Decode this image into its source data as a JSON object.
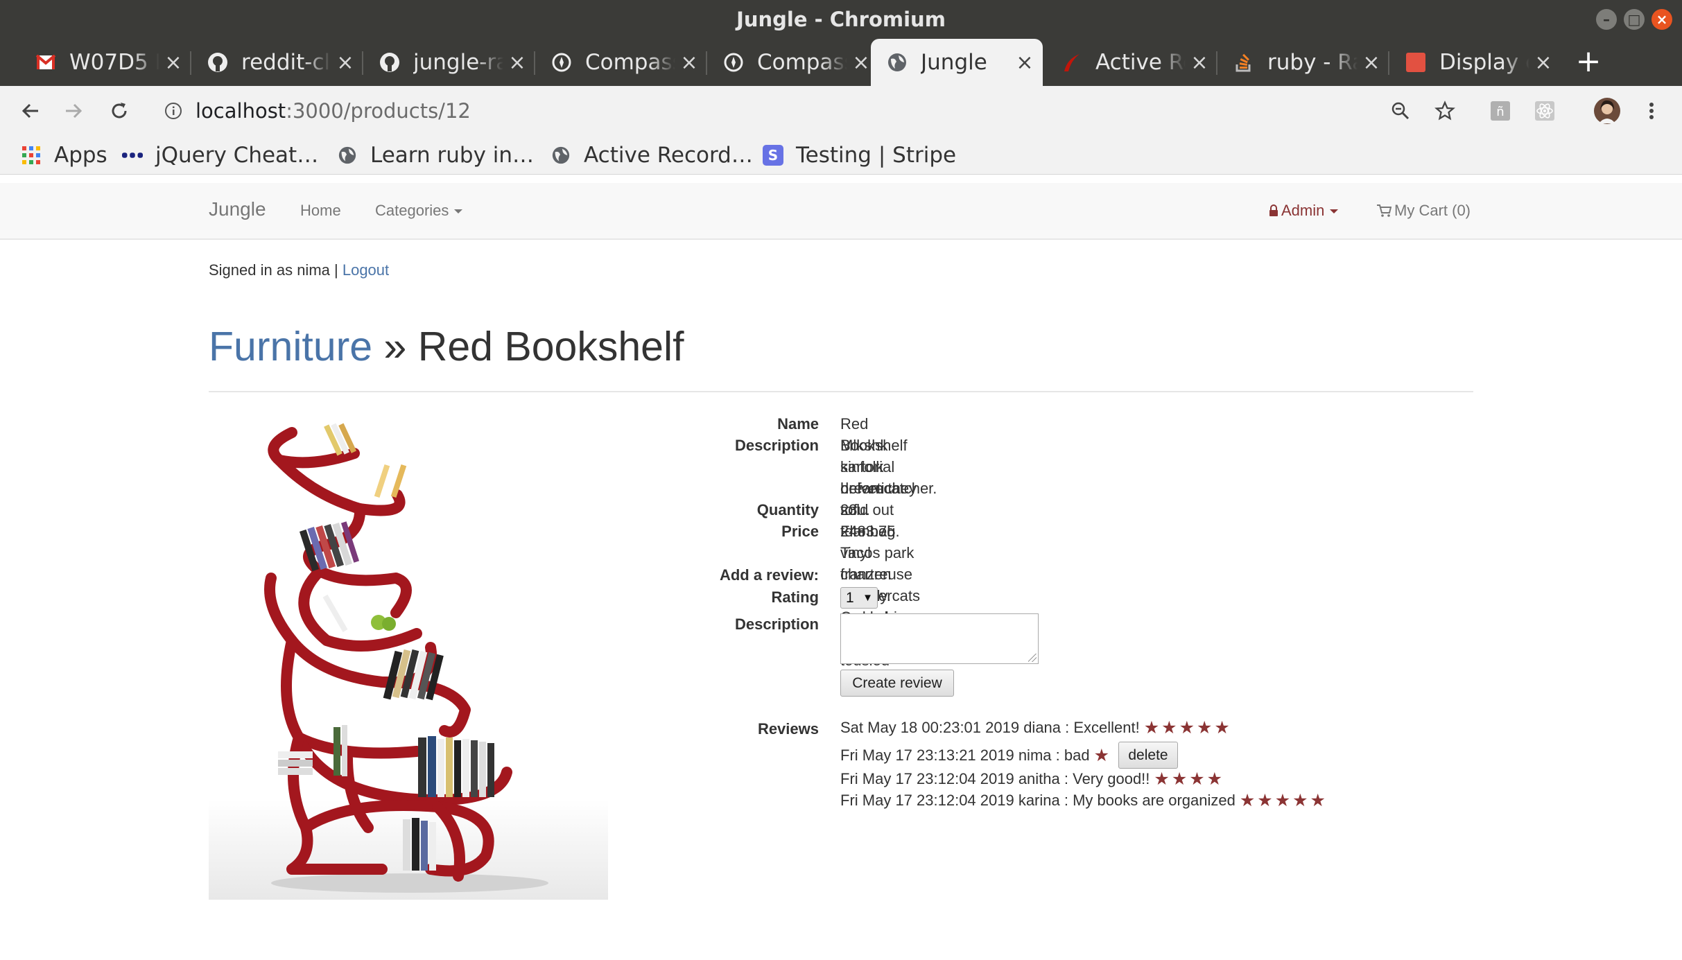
{
  "window": {
    "title": "Jungle - Chromium"
  },
  "tabs": [
    {
      "title": "W07D5 L",
      "icon": "gmail-icon"
    },
    {
      "title": "reddit-cl",
      "icon": "github-icon"
    },
    {
      "title": "jungle-ra",
      "icon": "github-icon"
    },
    {
      "title": "Compass",
      "icon": "compass-icon"
    },
    {
      "title": "Compass",
      "icon": "compass-icon"
    },
    {
      "title": "Jungle",
      "icon": "globe-icon"
    },
    {
      "title": "Active Re",
      "icon": "rails-icon"
    },
    {
      "title": "ruby - Ra",
      "icon": "stackoverflow-icon"
    },
    {
      "title": "Display c",
      "icon": "square-icon"
    }
  ],
  "toolbar": {
    "url_host": "localhost",
    "url_path": ":3000/products/12"
  },
  "bookmarks": [
    {
      "label": "Apps"
    },
    {
      "label": "jQuery Cheat…"
    },
    {
      "label": "Learn ruby in…"
    },
    {
      "label": "Active Record…"
    },
    {
      "label": "Testing | Stripe"
    }
  ],
  "site_nav": {
    "brand": "Jungle",
    "home": "Home",
    "categories": "Categories",
    "admin": "Admin",
    "cart": "My Cart (0)"
  },
  "session": {
    "signed_in_text": "Signed in as nima |",
    "logout": "Logout"
  },
  "page": {
    "category": "Furniture",
    "separator": "»",
    "product_name": "Red Bookshelf"
  },
  "details": {
    "name_label": "Name",
    "name_value": "Red Bookshelf",
    "description_label": "Description",
    "description_lines": [
      "Mlkshk kinfolk before they sold out tote bag. Tacos park franzen thundercats godard",
      "sartorial helvetica tofu. Flannel vinyl chartreuse literally. Cred chia biodiesel tousled",
      "dreamcatcher."
    ],
    "quantity_label": "Quantity",
    "quantity_value": "23",
    "price_label": "Price",
    "price_value": "2483.75"
  },
  "review_form": {
    "heading": "Add a review:",
    "rating_label": "Rating",
    "rating_value": "1",
    "description_label": "Description",
    "submit_label": "Create review"
  },
  "reviews": {
    "label": "Reviews",
    "items": [
      {
        "text": "Sat May 18 00:23:01 2019 diana : Excellent!",
        "stars": "★★★★★",
        "rating": 5
      },
      {
        "text": "Fri May 17 23:13:21 2019 nima : bad",
        "stars": "★",
        "rating": 1,
        "delete_label": "delete"
      },
      {
        "text": "Fri May 17 23:12:04 2019 anitha : Very good!!",
        "stars": "★★★★",
        "rating": 4
      },
      {
        "text": "Fri May 17 23:12:04 2019 karina : My books are organized",
        "stars": "★★★★★",
        "rating": 5
      }
    ]
  },
  "colors": {
    "accent_link": "#4a74a8",
    "star": "#8b3434",
    "bookshelf": "#a3171e"
  }
}
